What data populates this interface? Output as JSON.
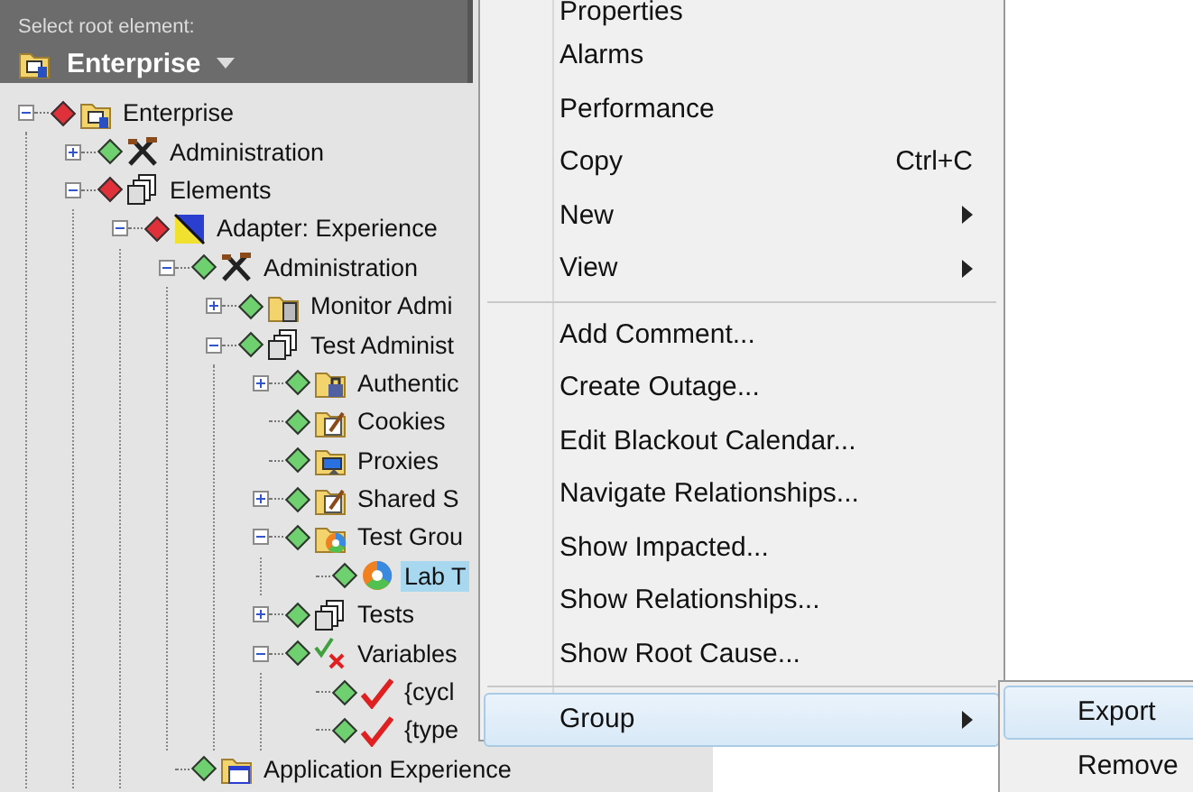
{
  "header": {
    "label": "Select root element:",
    "root": "Enterprise"
  },
  "tree": [
    {
      "label": "Enterprise",
      "kind": "enterprise",
      "color": "#e0313a",
      "expanded": true,
      "selected": false,
      "children": [
        {
          "label": "Administration",
          "kind": "tools",
          "color": "#6fd06f",
          "expanded": false,
          "selected": false
        },
        {
          "label": "Elements",
          "kind": "stack",
          "color": "#e0313a",
          "expanded": true,
          "selected": false,
          "children": [
            {
              "label": "Adapter: Experience",
              "kind": "adapter",
              "color": "#e0313a",
              "expanded": true,
              "selected": false,
              "children": [
                {
                  "label": "Administration",
                  "kind": "tools",
                  "color": "#6fd06f",
                  "expanded": true,
                  "selected": false,
                  "children": [
                    {
                      "label": "Monitor Admi",
                      "kind": "folder-server",
                      "color": "#6fd06f",
                      "expanded": false,
                      "selected": false
                    },
                    {
                      "label": "Test Administ",
                      "kind": "doc-stack",
                      "color": "#6fd06f",
                      "expanded": true,
                      "selected": false,
                      "children": [
                        {
                          "label": "Authentic",
                          "kind": "folder-lock",
                          "color": "#6fd06f",
                          "expanded": false,
                          "selected": false
                        },
                        {
                          "label": "Cookies",
                          "kind": "folder-edit",
                          "color": "#6fd06f",
                          "selected": false
                        },
                        {
                          "label": "Proxies",
                          "kind": "folder-monitor",
                          "color": "#6fd06f",
                          "selected": false
                        },
                        {
                          "label": "Shared S",
                          "kind": "folder-edit",
                          "color": "#6fd06f",
                          "expanded": false,
                          "selected": false
                        },
                        {
                          "label": "Test Grou",
                          "kind": "folder-ball",
                          "color": "#6fd06f",
                          "expanded": true,
                          "selected": false,
                          "children": [
                            {
                              "label": "Lab T",
                              "kind": "ball",
                              "color": "#6fd06f",
                              "selected": true
                            }
                          ]
                        },
                        {
                          "label": "Tests",
                          "kind": "doc-stack",
                          "color": "#6fd06f",
                          "expanded": false,
                          "selected": false
                        },
                        {
                          "label": "Variables",
                          "kind": "variables",
                          "color": "#6fd06f",
                          "expanded": true,
                          "selected": false,
                          "children": [
                            {
                              "label": "{cycl",
                              "kind": "check",
                              "color": "#6fd06f",
                              "selected": false
                            },
                            {
                              "label": "{type",
                              "kind": "check",
                              "color": "#6fd06f",
                              "selected": false
                            }
                          ]
                        }
                      ]
                    }
                  ]
                },
                {
                  "label": "Application Experience",
                  "kind": "folder-app",
                  "color": "#6fd06f",
                  "selected": false
                }
              ]
            }
          ]
        }
      ]
    }
  ],
  "context_menu": [
    {
      "kind": "item",
      "label": "Properties",
      "selected": false
    },
    {
      "kind": "item",
      "label": "Alarms",
      "selected": false
    },
    {
      "kind": "item",
      "label": "Performance",
      "selected": false
    },
    {
      "kind": "item",
      "label": "Copy",
      "shortcut": "Ctrl+C",
      "selected": false
    },
    {
      "kind": "submenu",
      "label": "New",
      "selected": false
    },
    {
      "kind": "submenu",
      "label": "View",
      "selected": false
    },
    {
      "kind": "separator"
    },
    {
      "kind": "item",
      "label": "Add Comment...",
      "selected": false
    },
    {
      "kind": "item",
      "label": "Create Outage...",
      "selected": false
    },
    {
      "kind": "item",
      "label": "Edit Blackout Calendar...",
      "selected": false
    },
    {
      "kind": "item",
      "label": "Navigate Relationships...",
      "selected": false
    },
    {
      "kind": "item",
      "label": "Show Impacted...",
      "selected": false
    },
    {
      "kind": "item",
      "label": "Show Relationships...",
      "selected": false
    },
    {
      "kind": "item",
      "label": "Show Root Cause...",
      "selected": false
    },
    {
      "kind": "separator"
    },
    {
      "kind": "submenu",
      "label": "Group",
      "selected": true
    }
  ],
  "submenu": [
    {
      "label": "Export",
      "selected": true
    },
    {
      "label": "Remove",
      "selected": false
    }
  ]
}
